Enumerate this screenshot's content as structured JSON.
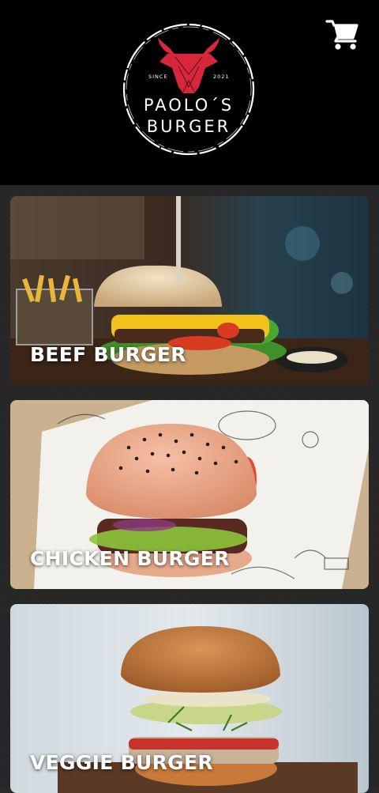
{
  "header": {
    "logo": {
      "since_label": "SINCE",
      "year_label": "2021",
      "name_line1": "PAOLO´S",
      "name_line2": "BURGER"
    },
    "cart_icon": "shopping-cart-icon"
  },
  "categories": [
    {
      "label": "BEEF BURGER"
    },
    {
      "label": "CHICKEN BURGER"
    },
    {
      "label": "VEGGIE BURGER"
    }
  ],
  "colors": {
    "header_bg": "#000000",
    "page_bg": "#262626",
    "bull_red": "#d8263a",
    "text": "#ffffff"
  }
}
